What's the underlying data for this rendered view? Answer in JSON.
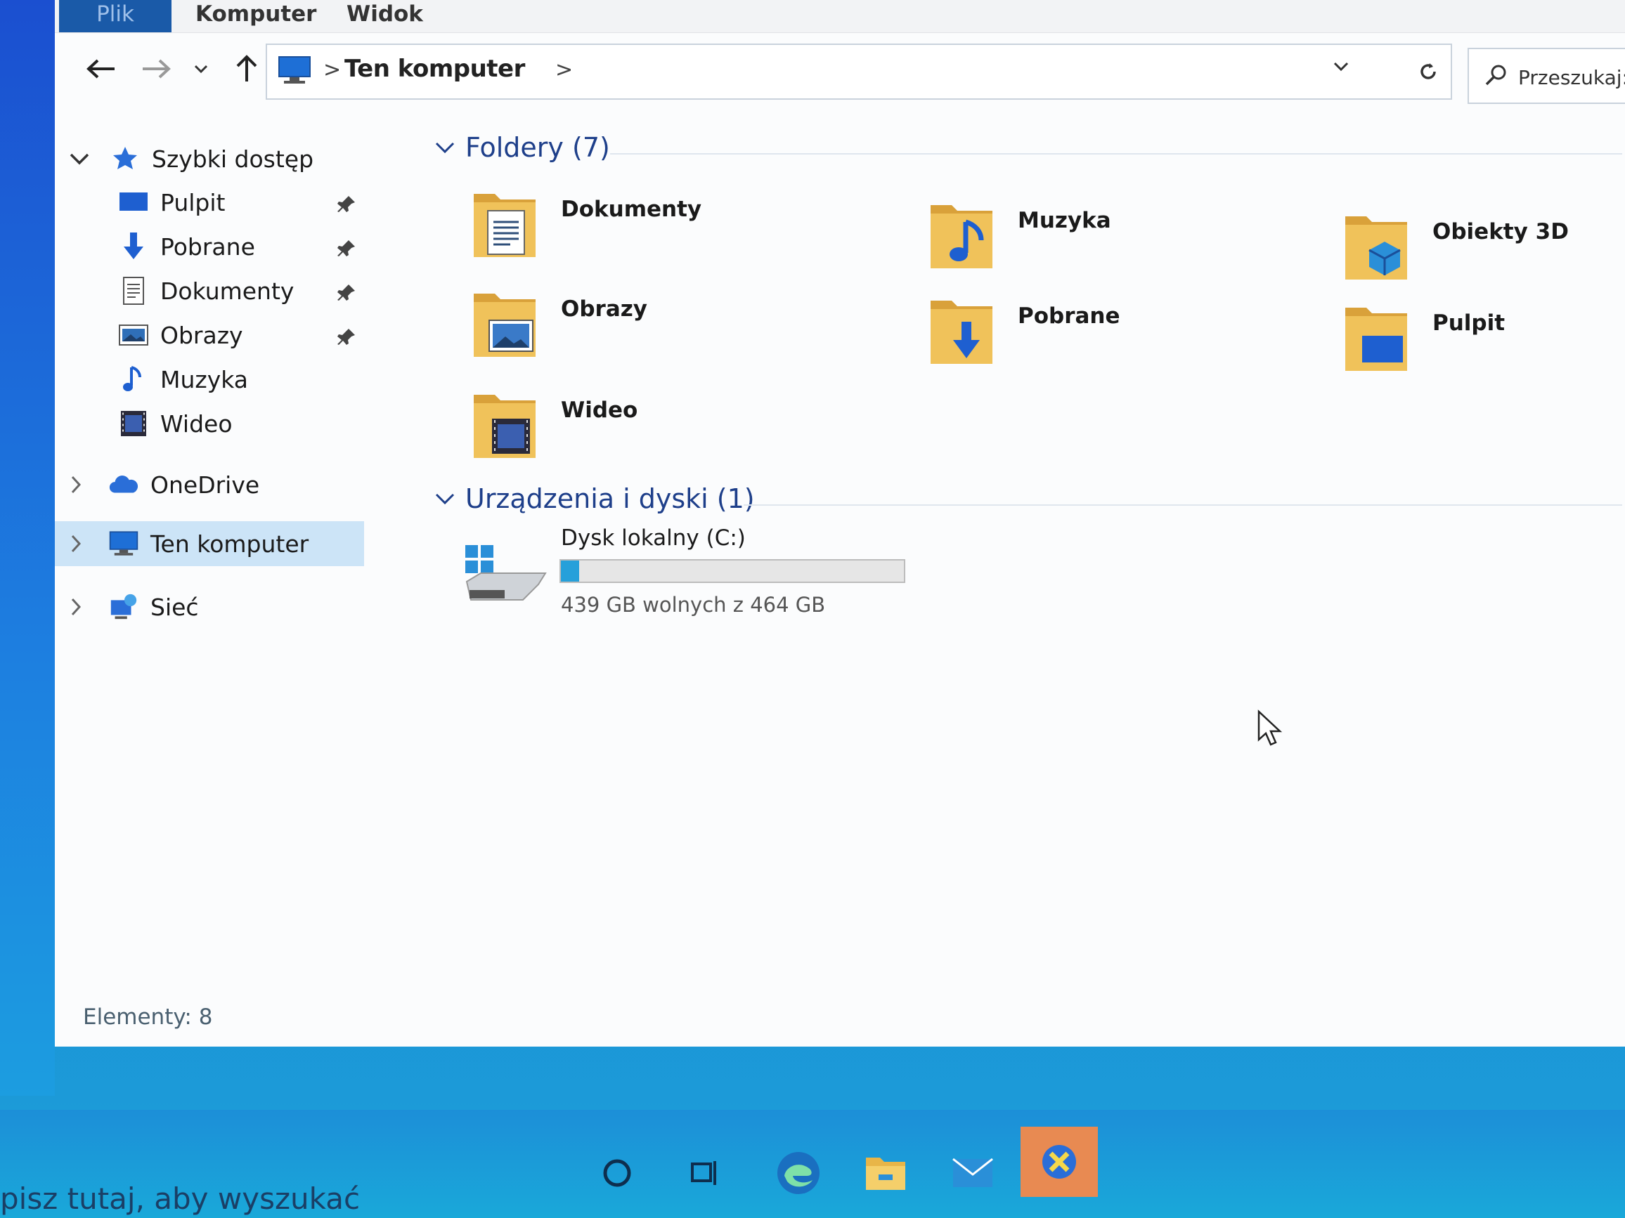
{
  "ribbon": {
    "tabs": [
      "Plik",
      "Komputer",
      "Widok"
    ]
  },
  "address": {
    "path_label": "Ten komputer",
    "separator": ">"
  },
  "search": {
    "placeholder": "Przeszukaj: Ten komputer"
  },
  "sidebar": {
    "quick_access": "Szybki dostęp",
    "quick_items": [
      {
        "label": "Pulpit",
        "pinned": true
      },
      {
        "label": "Pobrane",
        "pinned": true
      },
      {
        "label": "Dokumenty",
        "pinned": true
      },
      {
        "label": "Obrazy",
        "pinned": true
      },
      {
        "label": "Muzyka",
        "pinned": false
      },
      {
        "label": "Wideo",
        "pinned": false
      }
    ],
    "onedrive": "OneDrive",
    "this_pc": "Ten komputer",
    "network": "Sieć"
  },
  "content": {
    "folders_header": "Foldery (7)",
    "folders": [
      "Dokumenty",
      "Muzyka",
      "Obiekty 3D",
      "Obrazy",
      "Pobrane",
      "Pulpit",
      "Wideo"
    ],
    "devices_header": "Urządzenia i dyski (1)",
    "drive": {
      "label": "Dysk lokalny (C:)",
      "free_text": "439 GB wolnych z 464 GB",
      "used_fraction": 0.054
    }
  },
  "status": {
    "items_text": "Elementy: 8"
  },
  "taskbar": {
    "search_placeholder": "pisz tutaj, aby wyszukać"
  },
  "colors": {
    "accent": "#1a5aa8",
    "selection": "#cce4f7",
    "folder": "#e8b548",
    "drive_fill": "#26a0da"
  }
}
